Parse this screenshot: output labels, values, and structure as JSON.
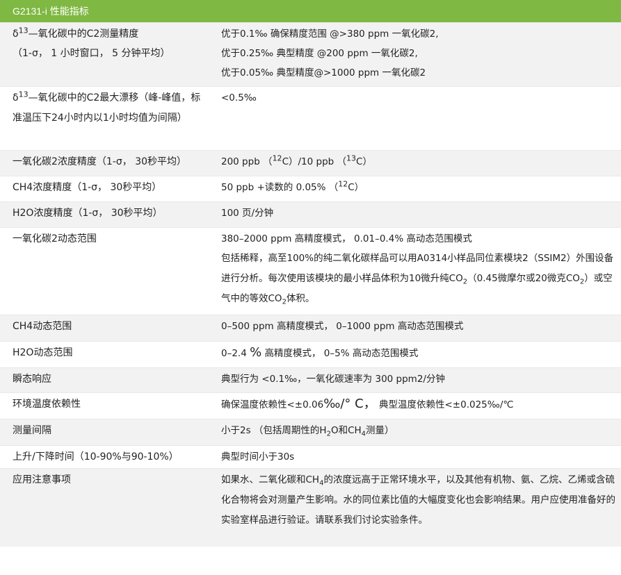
{
  "table": {
    "title": "G2131-i 性能指标",
    "rows": [
      {
        "label": [
          "δ",
          "13",
          "—氧化碳中的C2测量精度",
          "（1-σ， 1 小时窗口， 5 分钟平均）"
        ],
        "value": [
          "优于0.1‰ 确保精度范围  @>380 ppm 一氧化碳2,",
          "优于0.25‰ 典型精度  @200 ppm 一氧化碳2,",
          "优于0.05‰ 典型精度@>1000 ppm 一氧化碳2"
        ]
      },
      {
        "label": [
          "δ",
          "13",
          "—氧化碳中的C2最大漂移（峰-峰值，标准温压下24小时内以1小时均值为间隔）"
        ],
        "value": [
          "<0.5‰"
        ]
      },
      {
        "label": [
          "一氧化碳2浓度精度（1-σ， 30秒平均）"
        ],
        "value": [
          "200 ppb （",
          "12",
          "C）/10 ppb （",
          "13",
          "C）"
        ]
      },
      {
        "label": [
          "CH4浓度精度（1-σ， 30秒平均）"
        ],
        "value": [
          "50 ppb +读数的 0.05% （",
          "12",
          "C）"
        ]
      },
      {
        "label": [
          "H2O浓度精度（1-σ， 30秒平均）"
        ],
        "value": [
          "100 页/分钟"
        ]
      },
      {
        "label": [
          "一氧化碳2动态范围"
        ],
        "value": [
          "380–2000 ppm 高精度模式， 0.01–0.4% 高动态范围模式",
          "包括稀释，高至100%的纯二氧化碳样品可以用A0314小样品同位素模块2（SSIM2）外围设备进行分析。每次使用该模块的最小样品体积为10微升纯CO",
          "2",
          "（0.45微摩尔或20微克CO",
          "2",
          "）或空气中的等效CO",
          "2",
          "体积。"
        ]
      },
      {
        "label": [
          "CH4动态范围"
        ],
        "value": [
          "0–500 ppm 高精度模式， 0–1000 ppm 高动态范围模式"
        ]
      },
      {
        "label": [
          "H2O动态范围"
        ],
        "value": [
          "0–2.4 ",
          "%",
          " 高精度模式， 0–5% 高动态范围模式"
        ]
      },
      {
        "label": [
          "瞬态响应"
        ],
        "value": [
          "典型行为 <0.1‰，一氧化碳速率为 300 ppm2/分钟"
        ]
      },
      {
        "label": [
          "环境温度依赖性"
        ],
        "value": [
          "确保温度依赖性<±0.06",
          "‰/° C，",
          " 典型温度依赖性<±0.025‰/℃"
        ]
      },
      {
        "label": [
          "测量间隔"
        ],
        "value": [
          "小于2s （包括周期性的H",
          "2",
          "O和CH",
          "4",
          "测量）"
        ]
      },
      {
        "label": [
          "上升/下降时间（10-90%与90-10%）"
        ],
        "value": [
          "典型时间小于30s"
        ]
      },
      {
        "label": [
          "应用注意事项"
        ],
        "value": [
          "如果水、二氧化碳和CH",
          "4",
          "的浓度远高于正常环境水平，以及其他有机物、氨、乙烷、乙烯或含硫化合物将会对测量产生影响。水的同位素比值的大幅度变化也会影响结果。用户应使用准备好的实验室样品进行验证。请联系我们讨论实验条件。"
        ]
      }
    ]
  }
}
